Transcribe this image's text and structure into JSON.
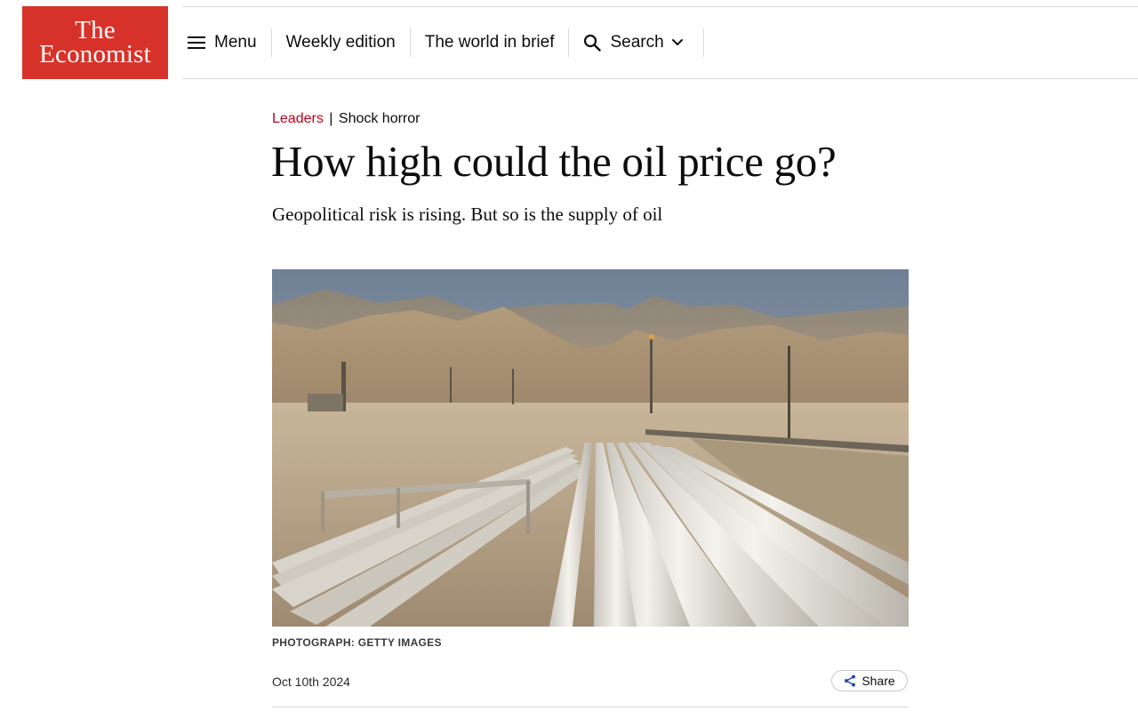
{
  "brand": {
    "line1": "The",
    "line2": "Economist",
    "color": "#d7322a"
  },
  "nav": {
    "menu_label": "Menu",
    "menu_icon": "hamburger-icon",
    "weekly_label": "Weekly edition",
    "brief_label": "The world in brief",
    "search_label": "Search",
    "search_icon": "search-icon",
    "search_chevron_icon": "chevron-down-icon"
  },
  "article": {
    "section": "Leaders",
    "separator": "|",
    "flytitle": "Shock horror",
    "headline": "How high could the oil price go?",
    "standfirst": "Geopolitical risk is rising. But so is the supply of oil",
    "image_credit": "PHOTOGRAPH: GETTY IMAGES",
    "date": "Oct 10th 2024",
    "share_label": "Share",
    "share_icon": "share-icon",
    "section_color": "#c0001f"
  }
}
